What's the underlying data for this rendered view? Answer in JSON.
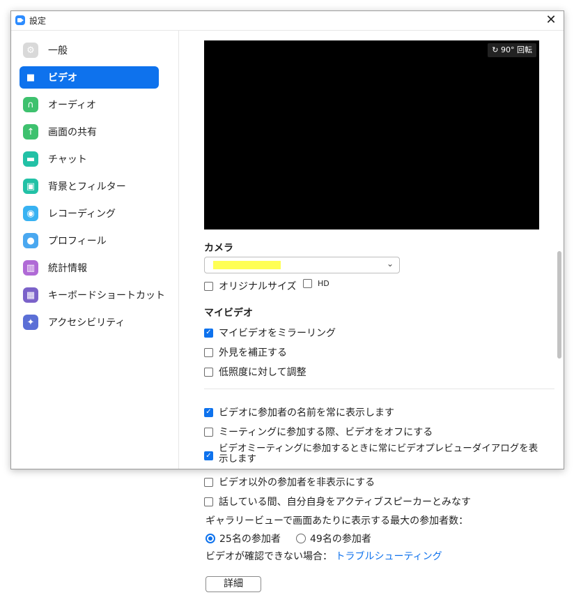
{
  "window": {
    "title": "設定"
  },
  "sidebar": {
    "items": [
      {
        "label": "一般",
        "icon": "gear-icon",
        "color": "#d9d9d9",
        "glyph": "⚙"
      },
      {
        "label": "ビデオ",
        "icon": "video-camera-icon",
        "color": "#ffffff",
        "glyph": "■",
        "active": true
      },
      {
        "label": "オーディオ",
        "icon": "headphones-icon",
        "color": "#3ec16e",
        "glyph": "∩"
      },
      {
        "label": "画面の共有",
        "icon": "share-screen-icon",
        "color": "#3ec16e",
        "glyph": "↑"
      },
      {
        "label": "チャット",
        "icon": "chat-icon",
        "color": "#22c1a6",
        "glyph": "▬"
      },
      {
        "label": "背景とフィルター",
        "icon": "background-icon",
        "color": "#22c1a6",
        "glyph": "▣"
      },
      {
        "label": "レコーディング",
        "icon": "record-icon",
        "color": "#38b2f2",
        "glyph": "◉"
      },
      {
        "label": "プロフィール",
        "icon": "profile-icon",
        "color": "#4aa8f0",
        "glyph": "●"
      },
      {
        "label": "統計情報",
        "icon": "statistics-icon",
        "color": "#b06ad6",
        "glyph": "▥"
      },
      {
        "label": "キーボードショートカット",
        "icon": "keyboard-icon",
        "color": "#7b62c9",
        "glyph": "▦"
      },
      {
        "label": "アクセシビリティ",
        "icon": "accessibility-icon",
        "color": "#5b6fd6",
        "glyph": "✦"
      }
    ]
  },
  "video": {
    "rotate_label": "90° 回転",
    "camera_title": "カメラ",
    "original_size": {
      "label": "オリジナルサイズ",
      "checked": false
    },
    "hd": {
      "label": "HD",
      "checked": false
    },
    "my_video_title": "マイビデオ",
    "mirror": {
      "label": "マイビデオをミラーリング",
      "checked": true
    },
    "touch_up": {
      "label": "外見を補正する",
      "checked": false
    },
    "low_light": {
      "label": "低照度に対して調整",
      "checked": false
    },
    "show_names": {
      "label": "ビデオに参加者の名前を常に表示します",
      "checked": true
    },
    "turn_off_video": {
      "label": "ミーティングに参加する際、ビデオをオフにする",
      "checked": false
    },
    "preview_dialog": {
      "label": "ビデオミーティングに参加するときに常にビデオプレビューダイアログを表示します",
      "checked": true
    },
    "hide_non_video": {
      "label": "ビデオ以外の参加者を非表示にする",
      "checked": false
    },
    "spotlight_self": {
      "label": "話している間、自分自身をアクティブスピーカーとみなす",
      "checked": false
    },
    "gallery_label": "ギャラリービューで画面あたりに表示する最大の参加者数：",
    "gallery_options": [
      {
        "label": "25名の参加者",
        "selected": true
      },
      {
        "label": "49名の参加者",
        "selected": false
      }
    ],
    "troubleshoot_prefix": "ビデオが確認できない場合：",
    "troubleshoot_link": "トラブルシューティング",
    "advanced_button": "詳細"
  }
}
